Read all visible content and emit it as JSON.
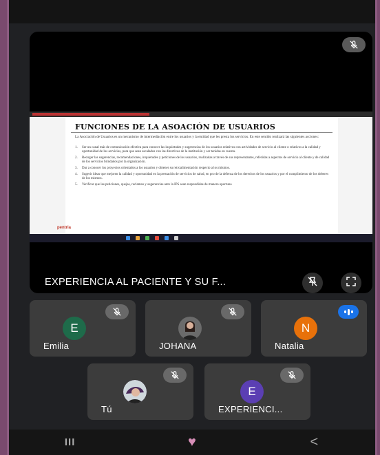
{
  "main_tile": {
    "name": "EXPERIENCIA AL PACIENTE Y SU F...",
    "slide": {
      "title": "FUNCIONES DE LA ASOACIÓN DE USUARIOS",
      "intro": "La Asociación de Usuarios es un mecanismo de intermediación entre los usuarios y la entidad que les presta los servicios. En este sentido realizará las siguientes acciones:",
      "items": [
        {
          "num": "1.",
          "text": "Ser un canal más de comunicación efectiva para conocer las inquietudes y sugerencias de los usuarios relativos con actividades de servicio al cliente o relativos a la calidad y oportunidad de los servicios, para que sean escalados con las directivas de la institución y ser tenidas en cuenta."
        },
        {
          "num": "2.",
          "text": "Recoger las sugerencias, recomendaciones, inquietudes y peticiones de los usuarios, realizadas a través de sus representantes, referidas a aspectos de servicio al cliente y de calidad de los servicios brindados por la organización."
        },
        {
          "num": "3.",
          "text": "Dar a conocer los proyectos orientados a los usuarios y obtener su retroalimentación respecto a los mismos."
        },
        {
          "num": "4.",
          "text": "Sugerir ideas que mejoren la calidad y oportunidad en la prestación de servicios de salud, en pro de la defensa de los derechos de los usuarios y por el cumplimiento de los deberes de los mismos."
        },
        {
          "num": "5.",
          "text": "Verificar que las peticiones, quejas, reclamos y sugerencias ante la IPS sean respondidas de manera oportuna"
        }
      ],
      "logo": "pentria"
    }
  },
  "participants": [
    {
      "name": "Emilia",
      "initial": "E",
      "color": "#1e6b4a",
      "status": "muted"
    },
    {
      "name": "JOHANA",
      "initial": "",
      "color": "#555555",
      "status": "muted"
    },
    {
      "name": "Natalia",
      "initial": "N",
      "color": "#e8710a",
      "status": "speaking"
    },
    {
      "name": "Tú",
      "initial": "",
      "color": "#7a5a8a",
      "status": "muted"
    },
    {
      "name": "EXPERIENCI...",
      "initial": "E",
      "color": "#5b3fb3",
      "status": "muted"
    }
  ],
  "icons": {
    "main_mic": "mic-off-icon",
    "pin": "unpin-icon",
    "fullscreen": "fullscreen-icon",
    "nav_recent": "recent-apps-icon",
    "nav_home": "heart-home-icon",
    "nav_back": "back-icon"
  },
  "nav": {
    "recent": "III",
    "home": "♥",
    "back": "<"
  }
}
